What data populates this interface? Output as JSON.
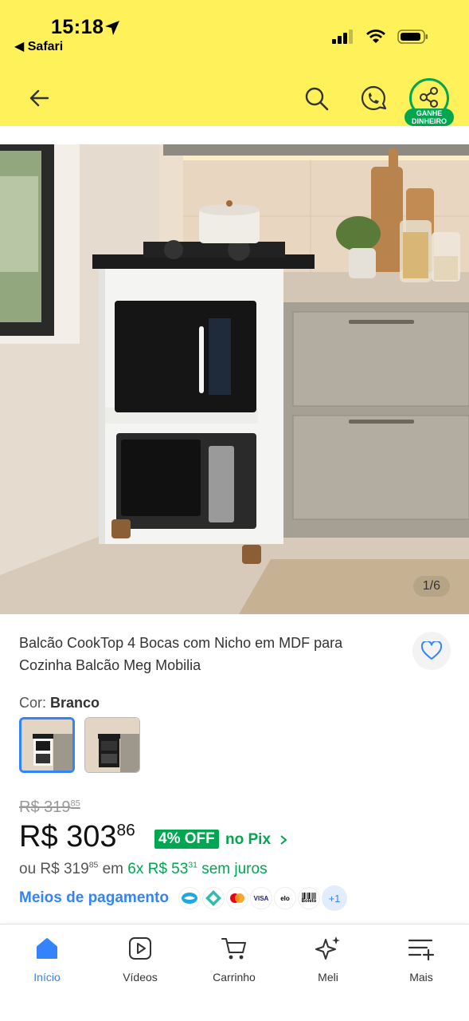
{
  "status_bar": {
    "time": "15:18",
    "back_app": "◀ Safari"
  },
  "header": {
    "share_badge_line1": "GANHE",
    "share_badge_line2": "DINHEIRO"
  },
  "gallery": {
    "counter": "1/6"
  },
  "product": {
    "title": "Balcão CookTop 4 Bocas com Nicho em MDF para Cozinha Balcão Meg Mobilia",
    "color_label": "Cor: ",
    "color_value": "Branco",
    "old_price_main": "R$ 319",
    "old_price_cents": "85",
    "price_main": "R$ 303",
    "price_cents": "86",
    "discount": "4% OFF",
    "pix_text": "no Pix",
    "installment_prefix": "ou R$ 319",
    "installment_prefix_cents": "85",
    "installment_mid": " em ",
    "installment_count": "6x R$ 53",
    "installment_cents": "31",
    "installment_suffix": " sem juros",
    "payment_link": "Meios de pagamento",
    "payment_more": "+1",
    "payment_icons": [
      "mercadopago-icon",
      "pix-icon",
      "mastercard-icon",
      "visa-icon",
      "elo-icon",
      "boleto-icon"
    ]
  },
  "payment_labels": {
    "visa": "VISA",
    "elo": "elo",
    "boleto": "Boleto"
  },
  "bottom_nav": [
    {
      "label": "Início",
      "icon": "home-icon",
      "active": true
    },
    {
      "label": "Vídeos",
      "icon": "play-icon",
      "active": false
    },
    {
      "label": "Carrinho",
      "icon": "cart-icon",
      "active": false
    },
    {
      "label": "Meli",
      "icon": "sparkle-icon",
      "active": false
    },
    {
      "label": "Mais",
      "icon": "menu-plus-icon",
      "active": false
    }
  ],
  "colors": {
    "header_yellow": "#fff159",
    "brand_blue": "#3483fa",
    "brand_green": "#00a650"
  }
}
